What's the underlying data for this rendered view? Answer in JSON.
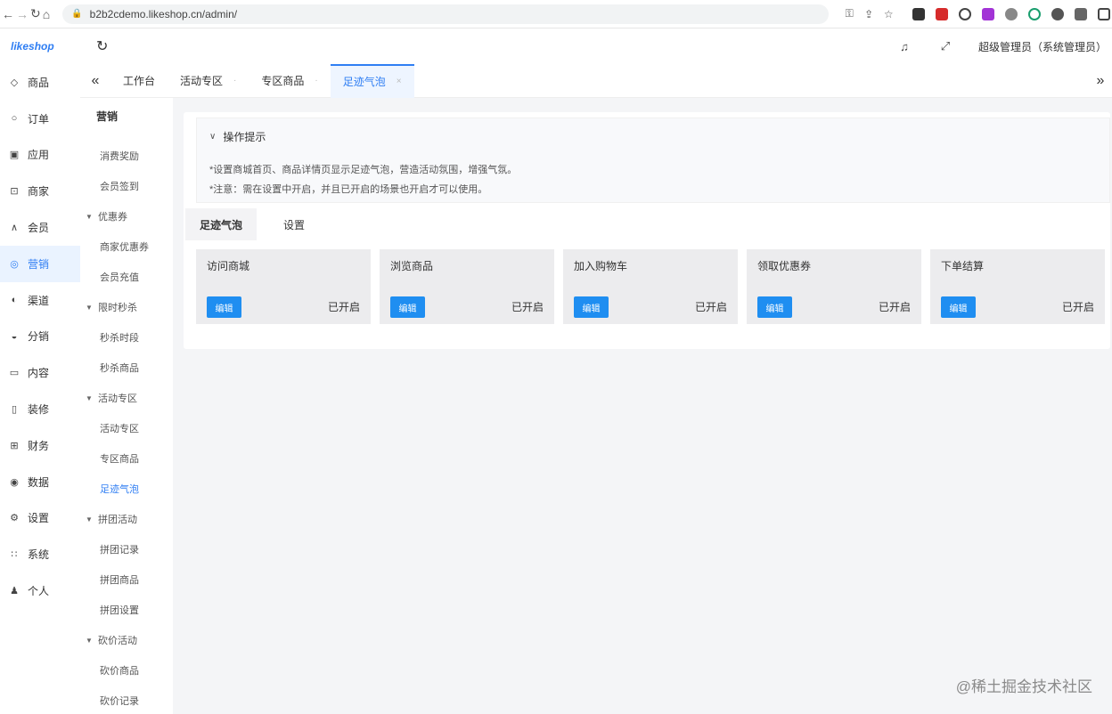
{
  "browser": {
    "url": "b2b2cdemo.likeshop.cn/admin/",
    "lock_icon": "🔒"
  },
  "header": {
    "logo": "likeshop",
    "admin_name": "超级管理员（系统管理员）"
  },
  "sidebar": {
    "items": [
      {
        "label": "商品",
        "icon": "tag-icon"
      },
      {
        "label": "订单",
        "icon": "order-icon"
      },
      {
        "label": "应用",
        "icon": "app-icon"
      },
      {
        "label": "商家",
        "icon": "shop-icon"
      },
      {
        "label": "会员",
        "icon": "user-icon"
      },
      {
        "label": "营销",
        "icon": "marketing-icon"
      },
      {
        "label": "渠道",
        "icon": "channel-icon"
      },
      {
        "label": "分销",
        "icon": "distribution-icon"
      },
      {
        "label": "内容",
        "icon": "content-icon"
      },
      {
        "label": "装修",
        "icon": "decoration-icon"
      },
      {
        "label": "财务",
        "icon": "finance-icon"
      },
      {
        "label": "数据",
        "icon": "data-icon"
      },
      {
        "label": "设置",
        "icon": "settings-icon"
      },
      {
        "label": "系统",
        "icon": "system-icon"
      },
      {
        "label": "个人",
        "icon": "person-icon"
      }
    ]
  },
  "tabs": [
    {
      "label": "工作台"
    },
    {
      "label": "活动专区"
    },
    {
      "label": "专区商品"
    },
    {
      "label": "足迹气泡"
    }
  ],
  "submenu": {
    "title": "营销",
    "entries": [
      {
        "kind": "item",
        "label": "消费奖励"
      },
      {
        "kind": "item",
        "label": "会员签到"
      },
      {
        "kind": "group",
        "label": "优惠券"
      },
      {
        "kind": "item",
        "label": "商家优惠券"
      },
      {
        "kind": "item",
        "label": "会员充值"
      },
      {
        "kind": "group",
        "label": "限时秒杀"
      },
      {
        "kind": "item",
        "label": "秒杀时段"
      },
      {
        "kind": "item",
        "label": "秒杀商品"
      },
      {
        "kind": "group",
        "label": "活动专区"
      },
      {
        "kind": "item",
        "label": "活动专区"
      },
      {
        "kind": "item",
        "label": "专区商品"
      },
      {
        "kind": "item",
        "label": "足迹气泡"
      },
      {
        "kind": "group",
        "label": "拼团活动"
      },
      {
        "kind": "item",
        "label": "拼团记录"
      },
      {
        "kind": "item",
        "label": "拼团商品"
      },
      {
        "kind": "item",
        "label": "拼团设置"
      },
      {
        "kind": "group",
        "label": "砍价活动"
      },
      {
        "kind": "item",
        "label": "砍价商品"
      },
      {
        "kind": "item",
        "label": "砍价记录"
      }
    ]
  },
  "tips": {
    "title": "操作提示",
    "lines": [
      "*设置商城首页、商品详情页显示足迹气泡，营造活动氛围，增强气氛。",
      "*注意：需在设置中开启，并且已开启的场景也开启才可以使用。"
    ]
  },
  "sub_tabs": [
    {
      "label": "足迹气泡"
    },
    {
      "label": "设置"
    }
  ],
  "cards": [
    {
      "title": "访问商城",
      "button": "编辑",
      "status": "已开启"
    },
    {
      "title": "浏览商品",
      "button": "编辑",
      "status": "已开启"
    },
    {
      "title": "加入购物车",
      "button": "编辑",
      "status": "已开启"
    },
    {
      "title": "领取优惠券",
      "button": "编辑",
      "status": "已开启"
    },
    {
      "title": "下单结算",
      "button": "编辑",
      "status": "已开启"
    }
  ],
  "watermark": "@稀土掘金技术社区",
  "colors": {
    "accent": "#2f7ef3",
    "button": "#1f8ef1",
    "card_bg": "#ececee"
  }
}
